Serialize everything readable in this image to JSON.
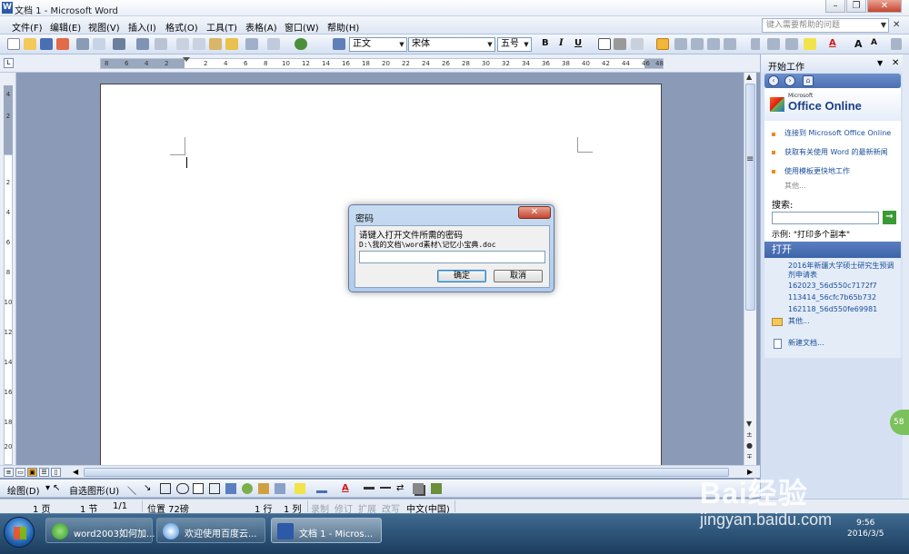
{
  "window": {
    "title": "文档 1 - Microsoft Word",
    "app_icon": "W"
  },
  "menu": {
    "items": [
      "文件(F)",
      "编辑(E)",
      "视图(V)",
      "插入(I)",
      "格式(O)",
      "工具(T)",
      "表格(A)",
      "窗口(W)",
      "帮助(H)"
    ],
    "help_placeholder": "键入需要帮助的问题"
  },
  "toolbar": {
    "style": "正文",
    "font": "宋体",
    "size": "五号",
    "bold": "B",
    "italic": "I",
    "underline": "U",
    "font_color_letter": "A",
    "grow": "A",
    "shrink": "A"
  },
  "ruler": {
    "ticks": [
      "8",
      "6",
      "4",
      "2",
      "2",
      "4",
      "6",
      "8",
      "10",
      "12",
      "14",
      "16",
      "18",
      "20",
      "22",
      "24",
      "26",
      "28",
      "30",
      "32",
      "34",
      "36",
      "38",
      "40",
      "42",
      "44",
      "46",
      "48"
    ],
    "vticks": [
      "4",
      "2",
      "2",
      "4",
      "6",
      "8",
      "10",
      "12",
      "14",
      "16",
      "18",
      "20"
    ]
  },
  "drawbar": {
    "draw_label": "绘图(D)",
    "autoshape_label": "自选图形(U)"
  },
  "statusbar": {
    "page": "1 页",
    "section": "1 节",
    "pages": "1/1",
    "position": "位置 72磅",
    "line": "1 行",
    "column": "1 列",
    "rec": "录制",
    "trk": "修订",
    "ext": "扩展",
    "ovr": "改写",
    "lang": "中文(中国)"
  },
  "taskpane": {
    "title": "开始工作",
    "office_small": "Microsoft",
    "office_logo": "Office Online",
    "links": [
      "连接到 Microsoft Office Online",
      "获取有关使用 Word 的最新新闻",
      "使用模板更快地工作"
    ],
    "more": "其他...",
    "search_label": "搜索:",
    "search_go": "→",
    "example": "示例: \"打印多个副本\"",
    "open_title": "打开",
    "recent": [
      "2016年新疆大学硕士研究生预调剂申请表",
      "162023_56d550c7172f7",
      "113414_56cfc7b65b732",
      "162118_56d550fe69981"
    ],
    "open_more": "其他...",
    "new_doc": "新建文档..."
  },
  "dialog": {
    "title": "密码",
    "close": "✕",
    "message": "请键入打开文件所需的密码",
    "path": "D:\\我的文档\\word素材\\记忆小宝典.doc",
    "password_value": "",
    "ok": "确定",
    "cancel": "取消"
  },
  "taskbar": {
    "items": [
      "word2003如何加...",
      "欢迎使用百度云...",
      "文档 1 - Micros..."
    ],
    "time": "9:56",
    "date": "2016/3/5"
  },
  "watermark": {
    "brand": "Bai经验",
    "url": "jingyan.baidu.com"
  },
  "side_badge": "58",
  "colors": {
    "accent": "#3d63a9",
    "close_red": "#c6452f",
    "link": "#1a4e9a"
  }
}
